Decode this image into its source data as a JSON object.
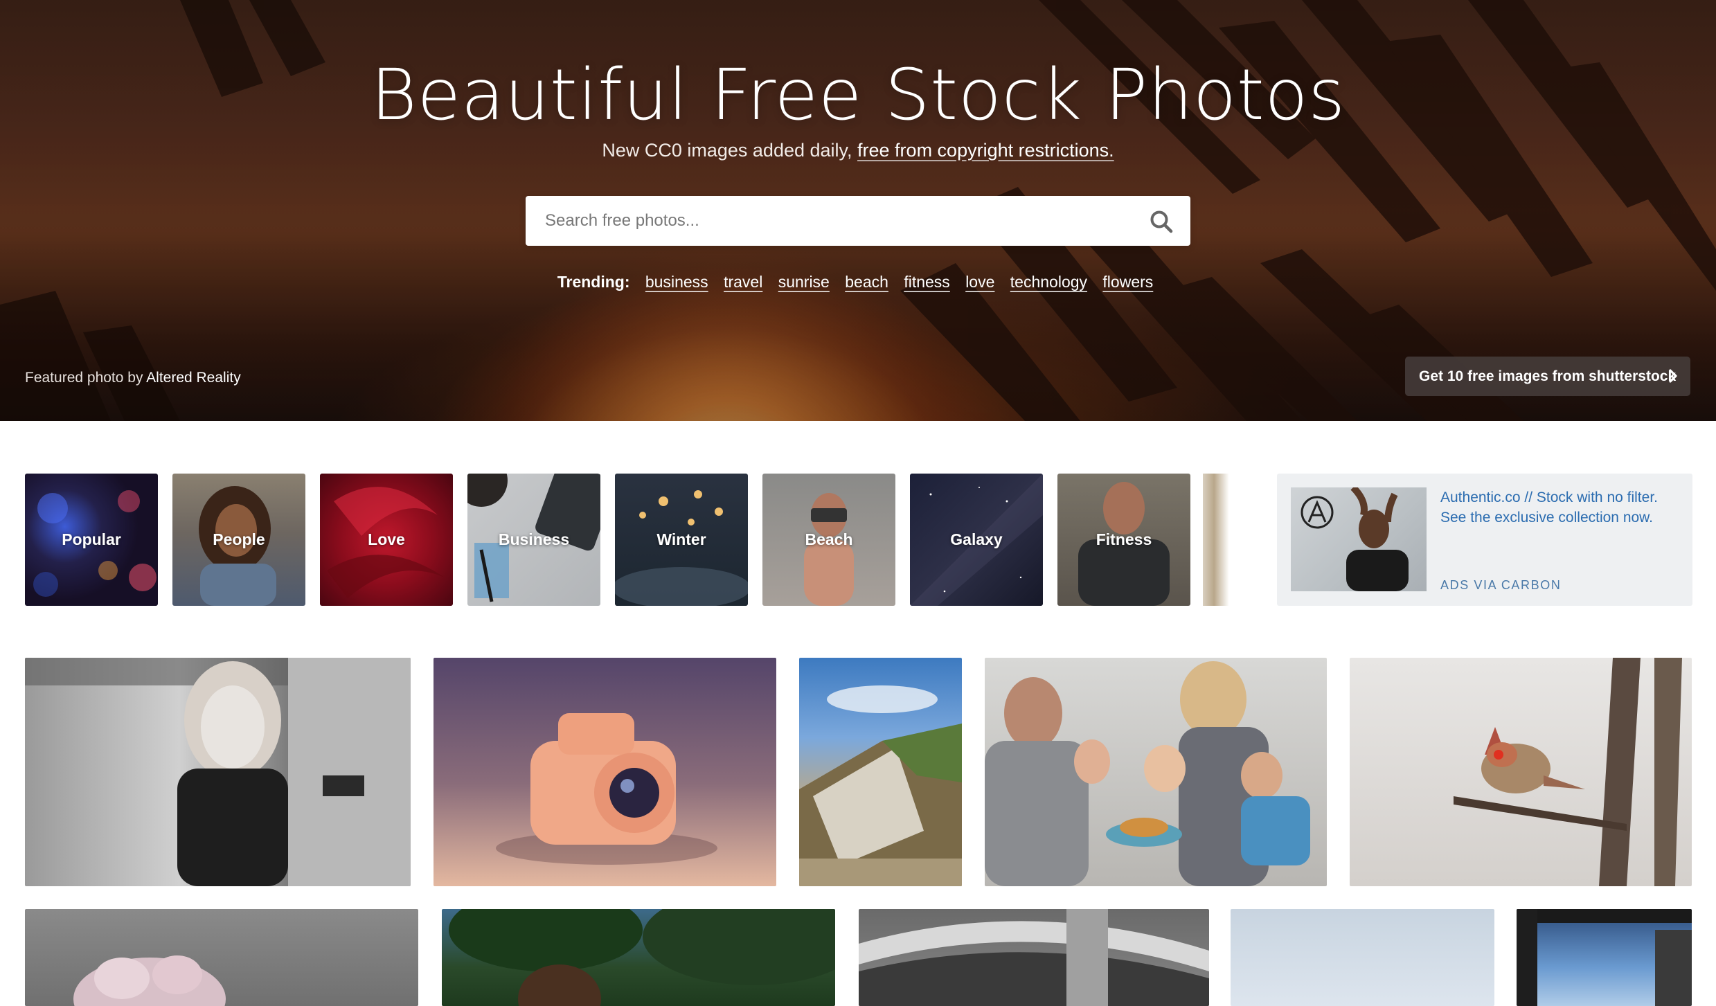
{
  "hero": {
    "title": "Beautiful Free Stock Photos",
    "subtitle_prefix": "New CC0 images added daily, ",
    "subtitle_link": "free from copyright restrictions.",
    "search_placeholder": "Search free photos...",
    "search_icon": "search-icon",
    "trending_label": "Trending:",
    "trending": [
      "business",
      "travel",
      "sunrise",
      "beach",
      "fitness",
      "love",
      "technology",
      "flowers"
    ],
    "featured_prefix": "Featured photo by ",
    "featured_author": "Altered Reality",
    "shutterstock_button": "Get 10 free images from shutterstock",
    "shutterstock_icon": "chevron-right-icon"
  },
  "categories": [
    "Popular",
    "People",
    "Love",
    "Business",
    "Winter",
    "Beach",
    "Galaxy",
    "Fitness"
  ],
  "ad": {
    "text": "Authentic.co // Stock with no filter. See the exclusive collection now.",
    "via": "ADS VIA CARBON"
  },
  "photos": {
    "row1": [
      "woman-portrait-bw",
      "orange-toy-camera",
      "coastal-cliff",
      "family-breakfast",
      "cardinal-bird"
    ],
    "row2": [
      "pink-flower",
      "man-portrait-trees",
      "architecture-bw",
      "sky",
      "window-view"
    ]
  },
  "colors": {
    "ad_link": "#2b6cb0",
    "hero_text": "#ffffff"
  }
}
